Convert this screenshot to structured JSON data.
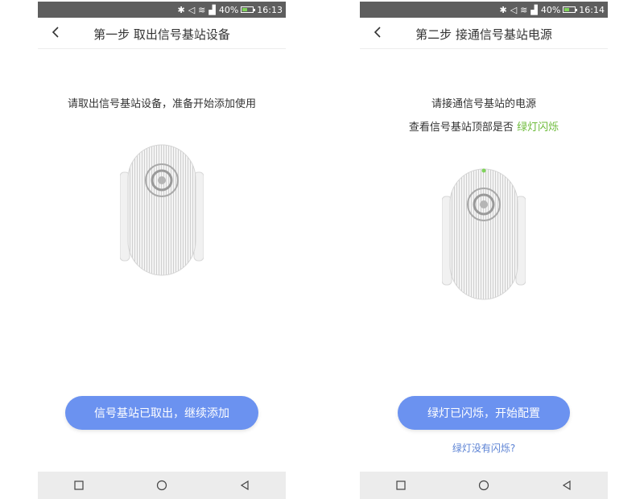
{
  "screens": [
    {
      "status": {
        "battery": "40%",
        "time": "16:13"
      },
      "title": "第一步 取出信号基站设备",
      "line1": "请取出信号基站设备，准备开始添加使用",
      "primary_button": "信号基站已取出，继续添加"
    },
    {
      "status": {
        "battery": "40%",
        "time": "16:14"
      },
      "title": "第二步 接通信号基站电源",
      "line1": "请接通信号基站的电源",
      "line2_prefix": "查看信号基站顶部是否 ",
      "line2_highlight": "绿灯闪烁",
      "primary_button": "绿灯已闪烁，开始配置",
      "secondary_link": "绿灯没有闪烁?"
    }
  ],
  "icons": {
    "bluetooth": "bluetooth-icon",
    "mute": "mute-icon",
    "wifi": "wifi-icon",
    "signal": "signal-icon",
    "battery": "battery-icon",
    "back": "back-chevron-icon",
    "recent": "recent-apps-icon",
    "home": "home-icon",
    "nav_back": "nav-back-icon"
  },
  "colors": {
    "status_bar": "#5e5e5e",
    "primary_button": "#6b92f0",
    "highlight_green": "#6dbb3a",
    "link_blue": "#5b82d4"
  }
}
